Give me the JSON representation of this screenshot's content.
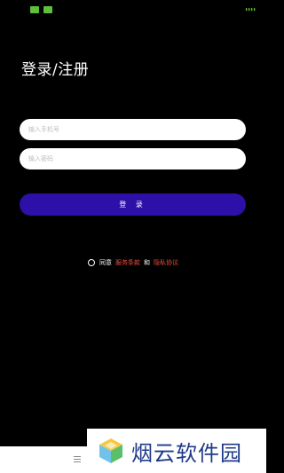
{
  "status_bar": {
    "left_icons": [
      "",
      ""
    ],
    "right_text": "▮▮▮▮"
  },
  "page": {
    "title": "登录/注册"
  },
  "form": {
    "phone_placeholder": "输入手机号",
    "password_placeholder": "输入密码",
    "login_label": "登 录"
  },
  "agreement": {
    "prefix": "同意",
    "terms": "服务条款",
    "and": "和",
    "privacy": "隐私协议"
  },
  "watermark": {
    "text": "烟云软件园"
  },
  "colors": {
    "background": "#000000",
    "button": "#2c10a8",
    "link": "#e84c3d",
    "status_green": "#5fbf3a",
    "watermark_blue": "#1f3a8a"
  }
}
